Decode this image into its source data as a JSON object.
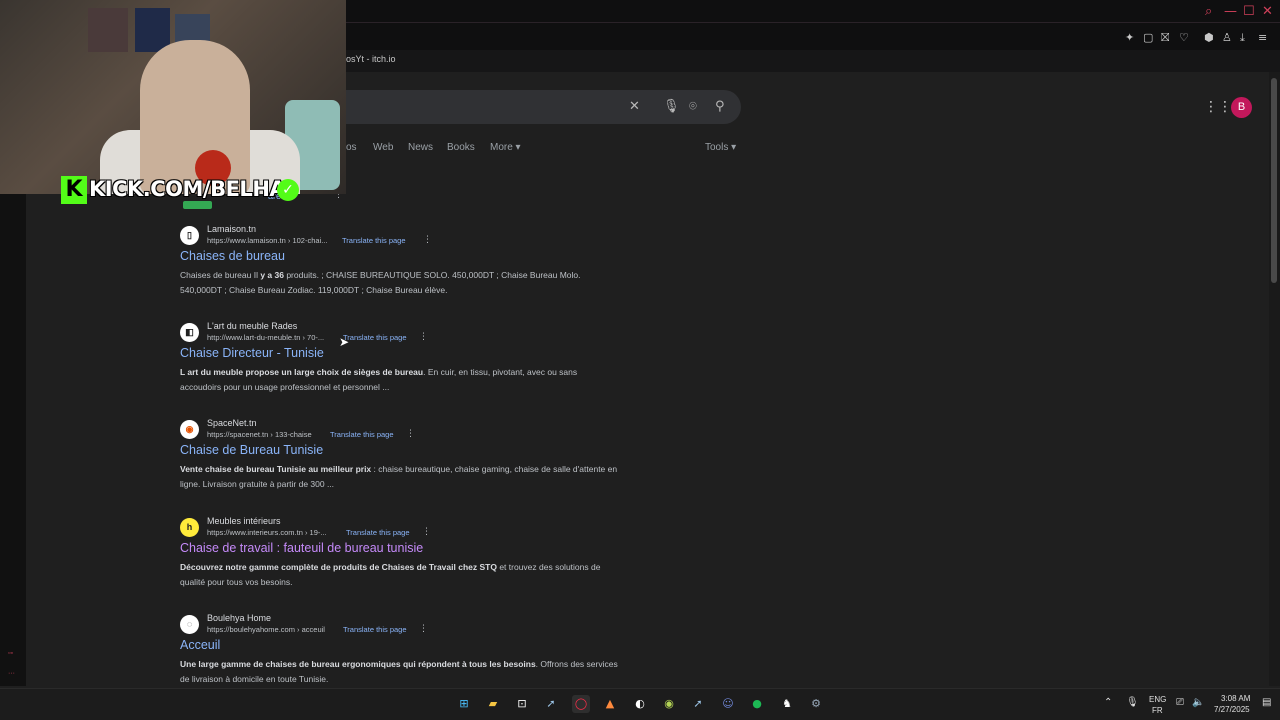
{
  "browser": {
    "bookmark_label": "osYt - itch.io"
  },
  "search": {
    "placeholder": ""
  },
  "nav": {
    "tabs": [
      {
        "label": "os"
      },
      {
        "label": "Web"
      },
      {
        "label": "News"
      },
      {
        "label": "Books"
      },
      {
        "label": "More ▾"
      }
    ],
    "tools_label": "Tools ▾"
  },
  "account": {
    "initial": "B"
  },
  "overlay": {
    "kick_channel": "KICK.COM/BELHA",
    "partial_link": "area"
  },
  "results": [
    {
      "favicon": "▯",
      "site_name": "Lamaison.tn",
      "url": "https://www.lamaison.tn › 102-chai...",
      "translate": "Translate this page",
      "title": "Chaises de bureau",
      "snippet_pre": "Chaises de bureau Il ",
      "snippet_bold": "y a 36",
      "snippet_post": " produits. ; CHAISE BUREAUTIQUE SOLO. 450,000DT ; Chaise Bureau Molo. 540,000DT ; Chaise Bureau Zodiac. 119,000DT ; Chaise Bureau élève."
    },
    {
      "favicon": "◧",
      "site_name": "L'art du meuble Rades",
      "url": "http://www.lart-du-meuble.tn › 70-...",
      "translate": "Translate this page",
      "title": "Chaise Directeur - Tunisie",
      "snippet_pre": "",
      "snippet_bold": "L art du meuble propose un large choix de sièges de bureau",
      "snippet_post": ". En cuir, en tissu, pivotant, avec ou sans accoudoirs pour un usage professionnel et personnel ..."
    },
    {
      "favicon": "◉",
      "site_name": "SpaceNet.tn",
      "url": "https://spacenet.tn › 133-chaise",
      "translate": "Translate this page",
      "title": "Chaise de Bureau Tunisie",
      "snippet_pre": "",
      "snippet_bold": "Vente chaise de bureau Tunisie au meilleur prix",
      "snippet_post": " : chaise bureautique, chaise gaming, chaise de salle d'attente en ligne. Livraison gratuite à partir de 300 ..."
    },
    {
      "favicon": "h",
      "site_name": "Meubles intérieurs",
      "url": "https://www.interieurs.com.tn › 19-...",
      "translate": "Translate this page",
      "title": "Chaise de travail : fauteuil de bureau tunisie",
      "snippet_pre": "",
      "snippet_bold": "Découvrez notre gamme complète de produits de Chaises de Travail chez STQ",
      "snippet_post": " et trouvez des solutions de qualité pour tous vos besoins."
    },
    {
      "favicon": "◌",
      "site_name": "Boulehya Home",
      "url": "https://boulehyahome.com › acceuil",
      "translate": "Translate this page",
      "title": "Acceuil",
      "snippet_pre": "",
      "snippet_bold": "Une large gamme de chaises de bureau ergonomiques qui répondent à tous les besoins",
      "snippet_post": ". Offrons des services de livraison à domicile en toute Tunisie."
    }
  ],
  "taskbar": {
    "lang_top": "ENG",
    "lang_bottom": "FR",
    "time": "3:08 AM",
    "date": "7/27/2025"
  },
  "colors": {
    "accent_link": "#8ab4f8",
    "visited_link": "#c58af9",
    "kick_green": "#53fc18",
    "avatar_bg": "#c2185b"
  }
}
